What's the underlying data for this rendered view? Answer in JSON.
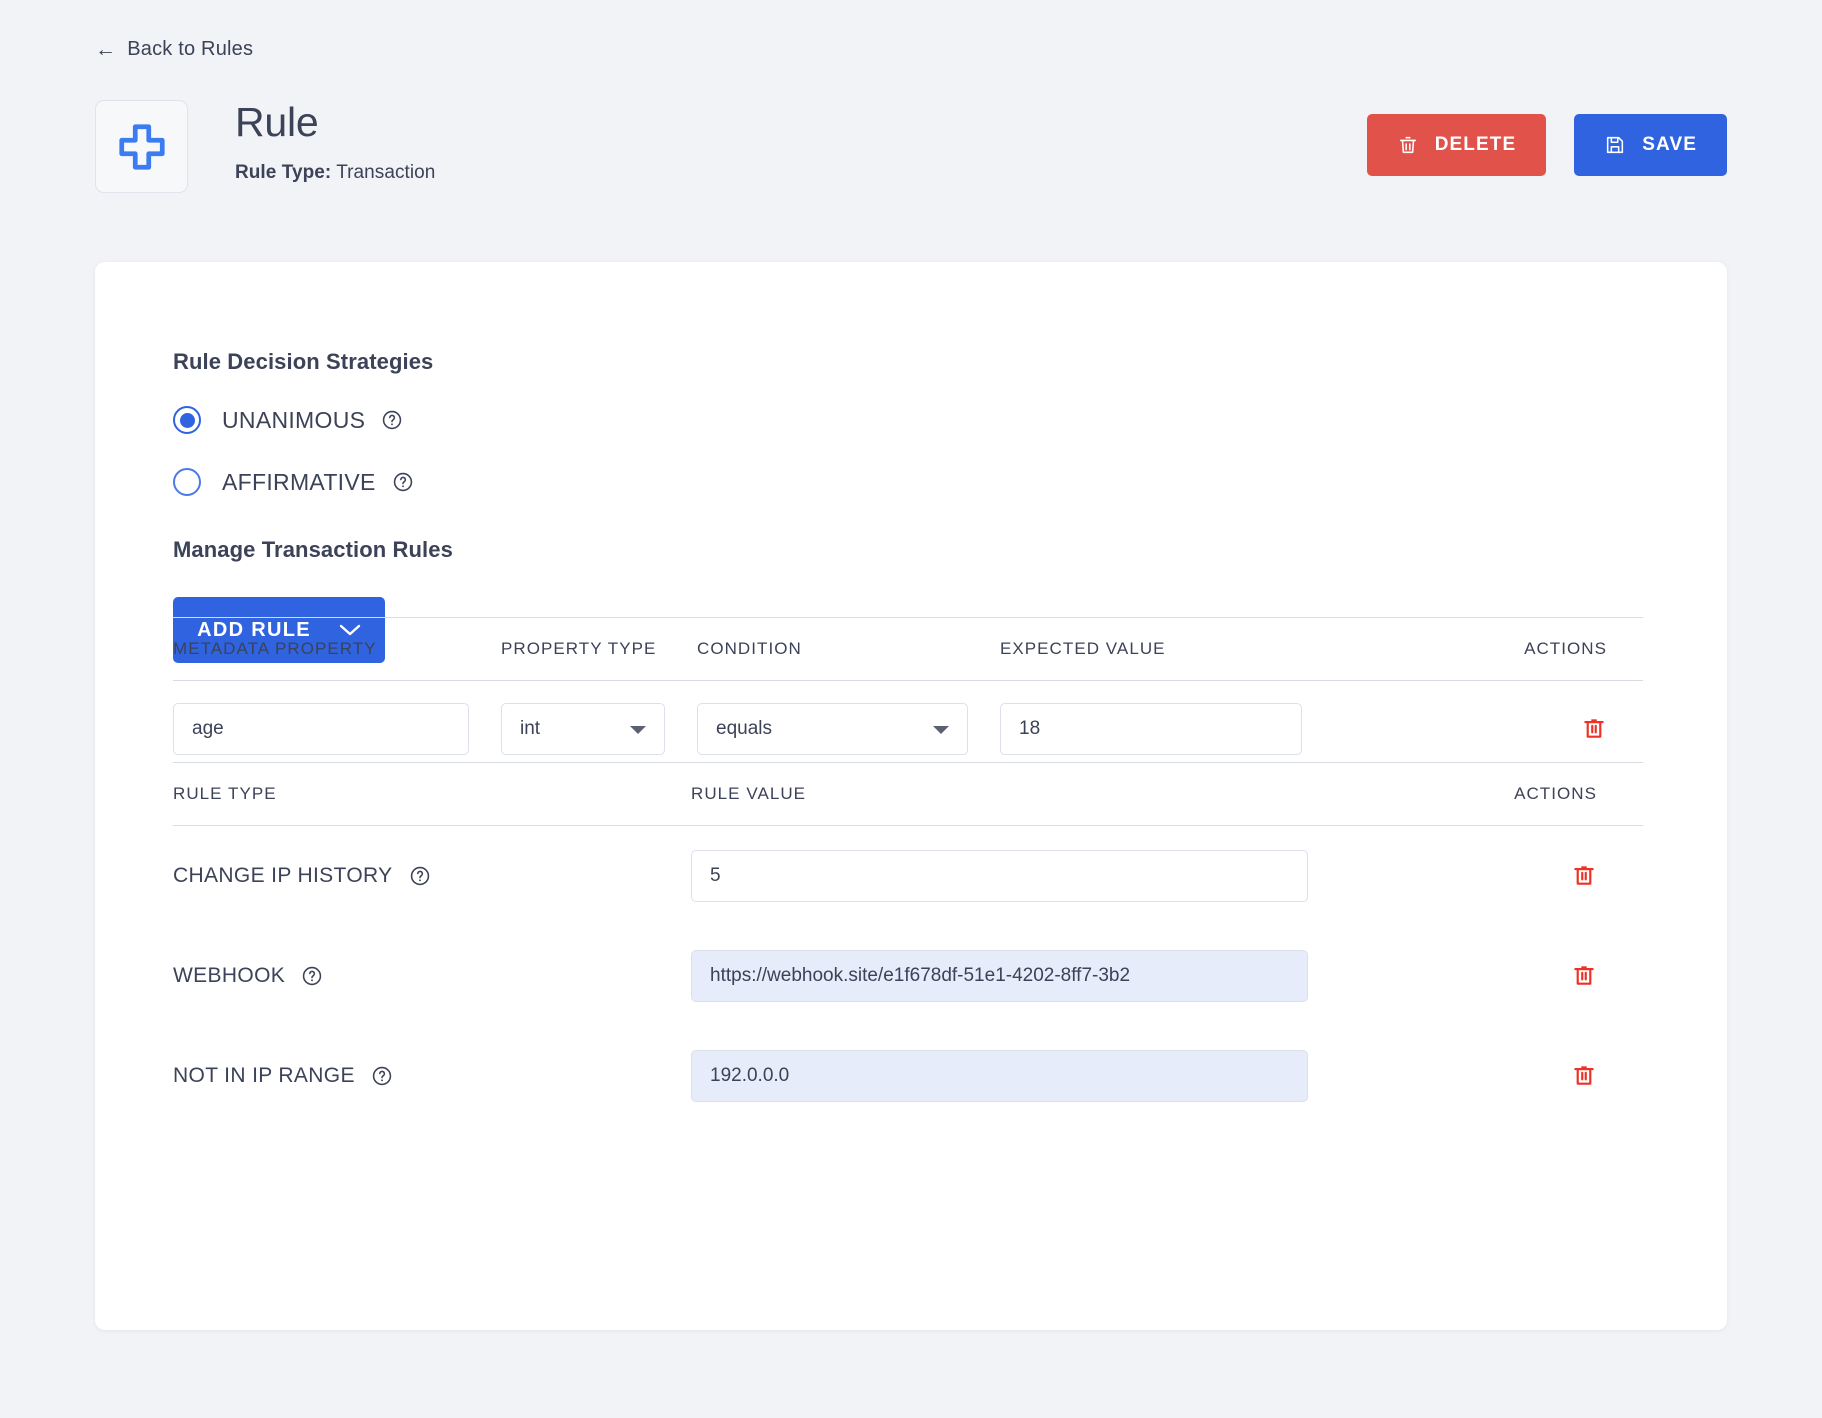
{
  "nav": {
    "back_label": "Back to Rules",
    "back_icon": "arrow-left-icon"
  },
  "header": {
    "badge_icon": "plus-cross-icon",
    "title": "Rule",
    "rule_type_label": "Rule Type:",
    "rule_type_value": "Transaction",
    "actions": {
      "delete_label": "DELETE",
      "delete_icon": "trash-icon",
      "save_label": "SAVE",
      "save_icon": "floppy-disk-icon"
    }
  },
  "strategies": {
    "title": "Rule Decision Strategies",
    "options": [
      {
        "label": "UNANIMOUS",
        "selected": true,
        "help_icon": "help-circle-icon"
      },
      {
        "label": "AFFIRMATIVE",
        "selected": false,
        "help_icon": "help-circle-icon"
      }
    ]
  },
  "manage": {
    "title": "Manage Transaction Rules",
    "add_rule_label": "ADD RULE",
    "add_rule_caret_icon": "chevron-down-icon"
  },
  "metadata_table": {
    "headers": {
      "property": "METADATA PROPERTY",
      "type": "PROPERTY TYPE",
      "condition": "CONDITION",
      "expected": "EXPECTED VALUE",
      "actions": "ACTIONS"
    },
    "rows": [
      {
        "property": "age",
        "type": "int",
        "condition": "equals",
        "expected": "18",
        "delete_icon": "trash-icon"
      }
    ]
  },
  "rules_table": {
    "headers": {
      "rule_type": "RULE TYPE",
      "rule_value": "RULE VALUE",
      "actions": "ACTIONS"
    },
    "rows": [
      {
        "rule_type": "CHANGE IP HISTORY",
        "help_icon": "help-circle-icon",
        "value": "5",
        "filled": false,
        "delete_icon": "trash-icon"
      },
      {
        "rule_type": "WEBHOOK",
        "help_icon": "help-circle-icon",
        "value": "https://webhook.site/e1f678df-51e1-4202-8ff7-3b2",
        "filled": true,
        "delete_icon": "trash-icon"
      },
      {
        "rule_type": "NOT IN IP RANGE",
        "help_icon": "help-circle-icon",
        "value": "192.0.0.0",
        "filled": true,
        "delete_icon": "trash-icon"
      }
    ]
  },
  "colors": {
    "page_bg": "#f2f3f7",
    "card_bg": "#ffffff",
    "primary_blue": "#2f63e0",
    "danger_red": "#e0524a",
    "trash_red": "#ee3124",
    "text": "#3c4257",
    "field_filled": "#e7ecfa",
    "border": "#dbe0ea"
  }
}
